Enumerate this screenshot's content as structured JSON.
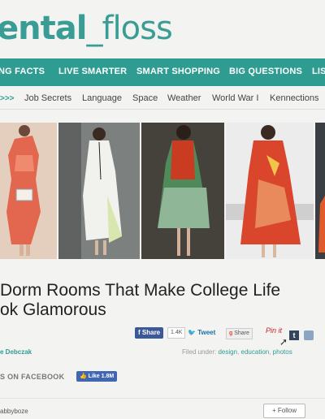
{
  "logo": {
    "part1": "ental",
    "part2": "_floss"
  },
  "nav": [
    {
      "label": "NG FACTS"
    },
    {
      "label": "LIVE SMARTER"
    },
    {
      "label": "SMART SHOPPING"
    },
    {
      "label": "BIG QUESTIONS"
    },
    {
      "label": "LIS"
    }
  ],
  "subnav": {
    "arrows": ">>>",
    "items": [
      {
        "label": "Job Secrets"
      },
      {
        "label": "Language"
      },
      {
        "label": "Space"
      },
      {
        "label": "Weather"
      },
      {
        "label": "World War I"
      },
      {
        "label": "Kennections"
      }
    ]
  },
  "article": {
    "title_line1": "Dorm Rooms That Make College Life",
    "title_line2": "ok Glamorous",
    "author": "e Debczak",
    "filed_label": "Filed under:",
    "tags": [
      "design",
      "education",
      "photos"
    ]
  },
  "share": {
    "facebook_label": "Share",
    "facebook_count": "1.4K",
    "tweet_label": "Tweet",
    "share_label": "Share",
    "pin_label": "Pin it",
    "tumblr_label": "t"
  },
  "social": {
    "facebook_label": "S ON FACEBOOK",
    "like_label": "Like 1.8M"
  },
  "footer": {
    "username": "abbyboze",
    "follow_label": "+ Follow"
  },
  "colors": {
    "brand_teal": "#2f9c92",
    "facebook_blue": "#3b5998"
  }
}
